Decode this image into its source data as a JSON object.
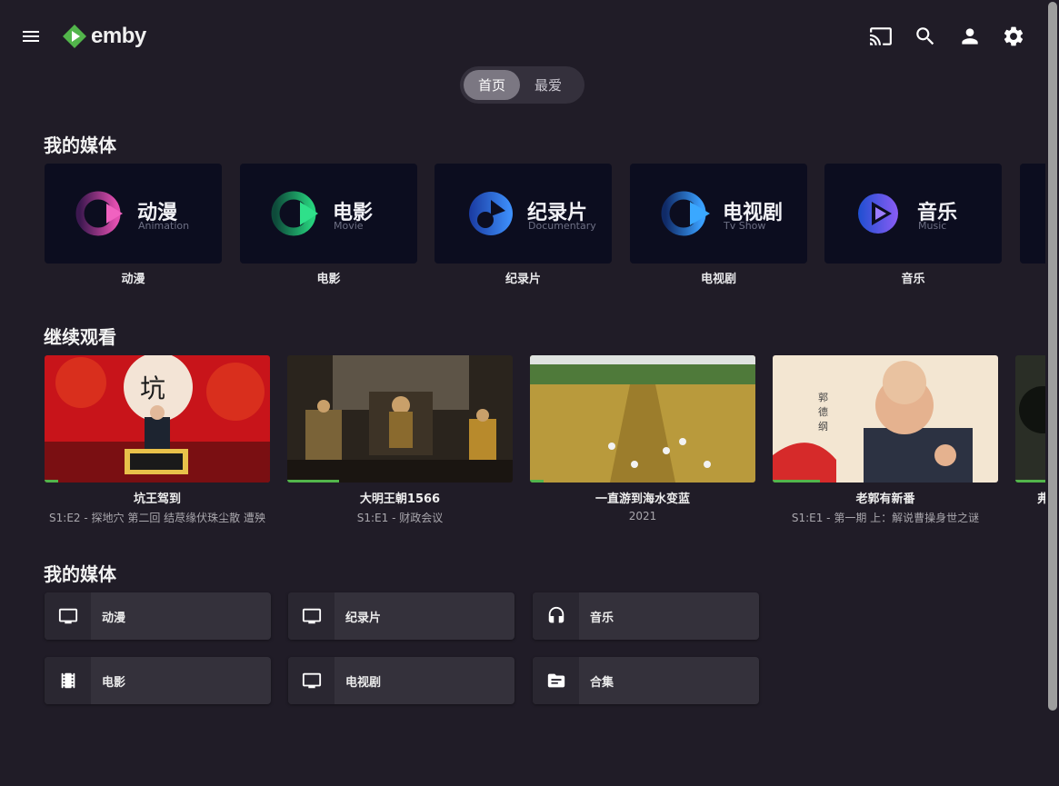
{
  "header": {
    "logo_text": "emby",
    "menu_icon": "hamburger-menu-icon",
    "icons": [
      "cast-icon",
      "search-icon",
      "user-icon",
      "settings-gear-icon"
    ]
  },
  "tabs": [
    {
      "label": "首页",
      "active": true
    },
    {
      "label": "最爱",
      "active": false
    }
  ],
  "sections": {
    "my_media_title": "我的媒体",
    "continue_watching_title": "继续观看",
    "my_media_list_title": "我的媒体"
  },
  "libraries": [
    {
      "title_zh": "动漫",
      "title_en": "Animation",
      "caption": "动漫",
      "color": "#e24fb0"
    },
    {
      "title_zh": "电影",
      "title_en": "Movie",
      "caption": "电影",
      "color": "#26d07c"
    },
    {
      "title_zh": "纪录片",
      "title_en": "Documentary",
      "caption": "纪录片",
      "color": "#2f7ff2"
    },
    {
      "title_zh": "电视剧",
      "title_en": "Tv Show",
      "caption": "电视剧",
      "color": "#3aa0ff"
    },
    {
      "title_zh": "音乐",
      "title_en": "Music",
      "caption": "音乐",
      "color": "#7f5af0"
    }
  ],
  "continue_watching": [
    {
      "title": "坑王驾到",
      "subtitle": "S1:E2 - 探地穴 第二回 结荩缘伏珠尘散 遭殃",
      "progress": 0.06
    },
    {
      "title": "大明王朝1566",
      "subtitle": "S1:E1 - 财政会议",
      "progress": 0.23
    },
    {
      "title": "一直游到海水变蓝",
      "subtitle": "2021",
      "progress": 0.06
    },
    {
      "title": "老郭有新番",
      "subtitle": "S1:E1 - 第一期 上：解说曹操身世之谜",
      "progress": 0.21
    },
    {
      "title": "弗",
      "subtitle": "",
      "progress": 0.3
    }
  ],
  "media_buttons": [
    {
      "label": "动漫",
      "icon": "tv-icon"
    },
    {
      "label": "纪录片",
      "icon": "tv-icon"
    },
    {
      "label": "音乐",
      "icon": "headphones-icon"
    },
    {
      "label": "电影",
      "icon": "film-icon"
    },
    {
      "label": "电视剧",
      "icon": "tv-icon"
    },
    {
      "label": "合集",
      "icon": "folder-icon"
    }
  ],
  "colors": {
    "background": "#201c27",
    "accent": "#52b54b",
    "button": "#34313b"
  }
}
